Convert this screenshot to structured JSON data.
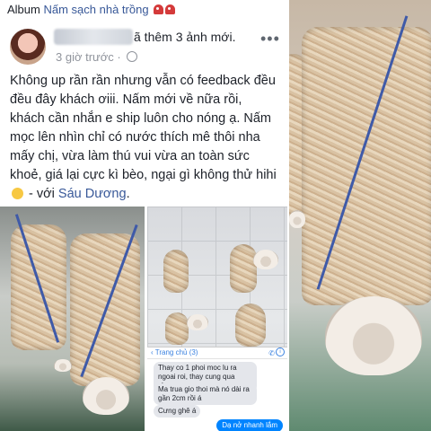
{
  "album": {
    "prefix": "Album",
    "name": "Nấm sạch nhà trồng"
  },
  "post": {
    "header_suffix": "ã thêm 3 ảnh mới.",
    "time": "3 giờ trước",
    "time_sep": "·",
    "more": "•••",
    "body": "Không up rần rần nhưng vẫn có feedback đều đều đây khách ơiii. Nấm mới về nữa rồi, khách cần nhắn e ship luôn cho nóng ạ. Nấm mọc lên nhìn chỉ có nước thích mê thôi nha mấy chị, vừa làm thú vui vừa an toàn sức khoẻ, giá lại cực kì bèo, ngại gì không thử hihi",
    "with_label": " - với ",
    "tagged": "Sáu Dương",
    "end": "."
  },
  "chat": {
    "back": "‹ Trang chủ (3)",
    "call_icon": "✆",
    "info_icon": "i",
    "messages": [
      {
        "text": "Thay co 1 phoi moc lu ra ngoai roi, thay cung qua chung"
      },
      {
        "text": "Ma trua gio thoi mà nó dài ra gần 2cm rồi á"
      },
      {
        "text": "Cưng ghê á"
      }
    ],
    "reply": "Dạ nở nhanh lắm"
  },
  "icons": [
    "mushroom-emoji-icon",
    "globe-icon",
    "more-icon",
    "smile-emoji-icon",
    "phone-icon",
    "info-icon"
  ],
  "colors": {
    "link": "#385898",
    "messenger_blue": "#0084ff",
    "text": "#1d2129",
    "meta": "#90949c"
  }
}
